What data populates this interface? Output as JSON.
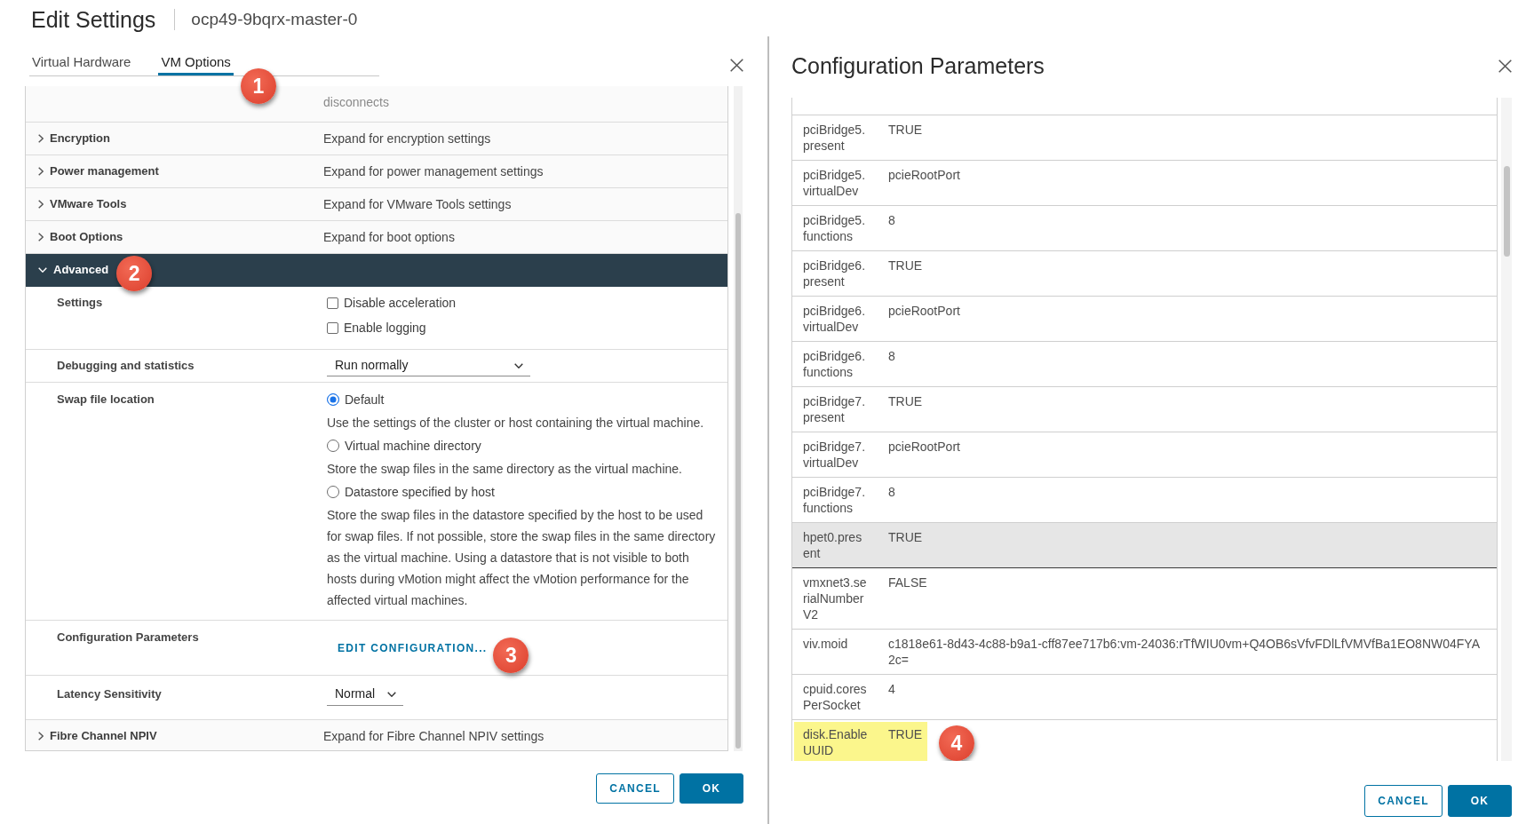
{
  "left_dialog": {
    "title": "Edit Settings",
    "subtitle": "ocp49-9bqrx-master-0",
    "tabs": [
      {
        "label": "Virtual Hardware",
        "selected": false
      },
      {
        "label": "VM Options",
        "selected": true,
        "callout": "1"
      }
    ],
    "rows": [
      {
        "kind": "continuation",
        "description": "disconnects"
      },
      {
        "kind": "section",
        "label": "Encryption",
        "description": "Expand for encryption settings",
        "expanded": false
      },
      {
        "kind": "section",
        "label": "Power management",
        "description": "Expand for power management settings",
        "expanded": false
      },
      {
        "kind": "section",
        "label": "VMware Tools",
        "description": "Expand for VMware Tools settings",
        "expanded": false
      },
      {
        "kind": "section",
        "label": "Boot Options",
        "description": "Expand for boot options",
        "expanded": false
      },
      {
        "kind": "section",
        "label": "Advanced",
        "expanded": true,
        "callout": "2",
        "children": [
          {
            "kind": "checkboxes",
            "label": "Settings",
            "options": [
              {
                "label": "Disable acceleration",
                "checked": false
              },
              {
                "label": "Enable logging",
                "checked": false
              }
            ]
          },
          {
            "kind": "select",
            "label": "Debugging and statistics",
            "value": "Run normally"
          },
          {
            "kind": "radios",
            "label": "Swap file location",
            "options": [
              {
                "label": "Default",
                "selected": true,
                "description": "Use the settings of the cluster or host containing the virtual machine."
              },
              {
                "label": "Virtual machine directory",
                "selected": false,
                "description": "Store the swap files in the same directory as the virtual machine."
              },
              {
                "label": "Datastore specified by host",
                "selected": false,
                "description": "Store the swap files in the datastore specified by the host to be used for swap files. If not possible, store the swap files in the same directory as the virtual machine. Using a datastore that is not visible to both hosts during vMotion might affect the vMotion performance for the affected virtual machines."
              }
            ]
          },
          {
            "kind": "link",
            "label": "Configuration Parameters",
            "link": "EDIT CONFIGURATION...",
            "callout": "3"
          },
          {
            "kind": "inline_select",
            "label": "Latency Sensitivity",
            "value": "Normal"
          }
        ]
      },
      {
        "kind": "section",
        "label": "Fibre Channel NPIV",
        "description": "Expand for Fibre Channel NPIV settings",
        "expanded": false
      }
    ],
    "buttons": [
      {
        "kind": "cancel",
        "label": "CANCEL"
      },
      {
        "kind": "confirm",
        "label": "OK"
      }
    ]
  },
  "right_dialog": {
    "title": "Configuration Parameters",
    "table": {
      "rows": [
        {
          "name": "pciBridge5.present",
          "value": "TRUE",
          "selected": false,
          "highlighted": false
        },
        {
          "name": "pciBridge5.virtualDev",
          "value": "pcieRootPort",
          "selected": false,
          "highlighted": false
        },
        {
          "name": "pciBridge5.functions",
          "value": "8",
          "selected": false,
          "highlighted": false
        },
        {
          "name": "pciBridge6.present",
          "value": "TRUE",
          "selected": false,
          "highlighted": false
        },
        {
          "name": "pciBridge6.virtualDev",
          "value": "pcieRootPort",
          "selected": false,
          "highlighted": false
        },
        {
          "name": "pciBridge6.functions",
          "value": "8",
          "selected": false,
          "highlighted": false
        },
        {
          "name": "pciBridge7.present",
          "value": "TRUE",
          "selected": false,
          "highlighted": false
        },
        {
          "name": "pciBridge7.virtualDev",
          "value": "pcieRootPort",
          "selected": false,
          "highlighted": false
        },
        {
          "name": "pciBridge7.functions",
          "value": "8",
          "selected": false,
          "highlighted": false
        },
        {
          "name": "hpet0.present",
          "value": "TRUE",
          "selected": true,
          "highlighted": false
        },
        {
          "name": "vmxnet3.serialNumberV2",
          "value": "FALSE",
          "selected": false,
          "highlighted": false
        },
        {
          "name": "viv.moid",
          "value": "c1818e61-8d43-4c88-b9a1-cff87ee717b6:vm-24036:rTfWIU0vm+Q4OB6sVfvFDlLfVMVfBa1EO8NW04FYA2c=",
          "selected": false,
          "highlighted": false
        },
        {
          "name": "cpuid.coresPerSocket",
          "value": "4",
          "selected": false,
          "highlighted": false
        },
        {
          "name": "disk.EnableUUID",
          "value": "TRUE",
          "selected": false,
          "highlighted": true,
          "callout": "4"
        }
      ]
    },
    "buttons": [
      {
        "kind": "cancel",
        "label": "CANCEL"
      },
      {
        "kind": "confirm",
        "label": "OK"
      }
    ]
  }
}
